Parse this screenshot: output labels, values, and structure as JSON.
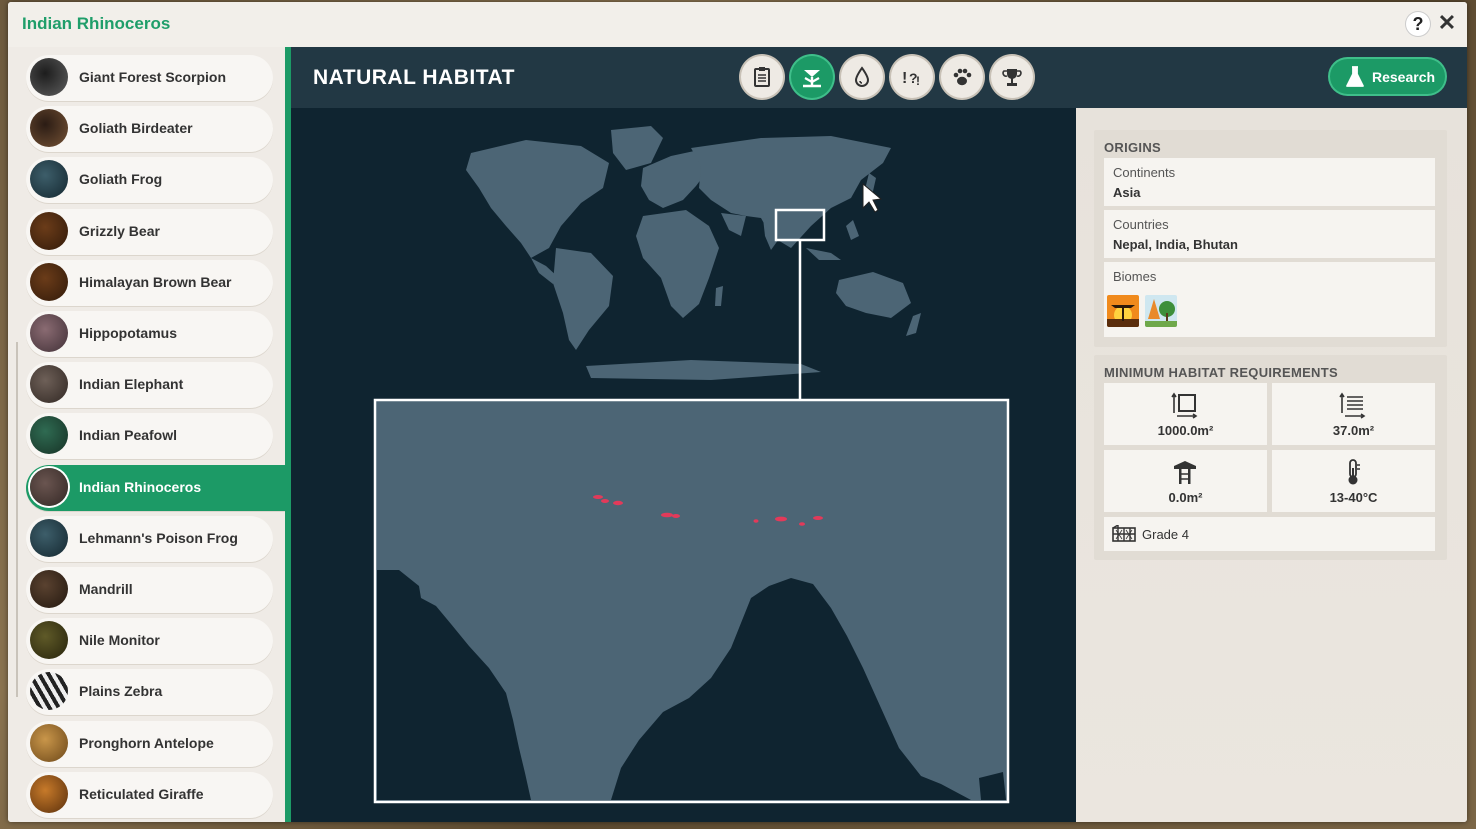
{
  "window": {
    "title": "Indian Rhinoceros",
    "help_label": "?",
    "close_label": "✕"
  },
  "sidebar": {
    "items": [
      {
        "label": "Giant Forest Scorpion",
        "icon": "scorpion-icon",
        "selected": false
      },
      {
        "label": "Goliath Birdeater",
        "icon": "spider-icon",
        "selected": false
      },
      {
        "label": "Goliath Frog",
        "icon": "frog-icon",
        "selected": false
      },
      {
        "label": "Grizzly Bear",
        "icon": "bear-icon",
        "selected": false
      },
      {
        "label": "Himalayan Brown Bear",
        "icon": "bear-icon",
        "selected": false
      },
      {
        "label": "Hippopotamus",
        "icon": "hippo-icon",
        "selected": false
      },
      {
        "label": "Indian Elephant",
        "icon": "elephant-icon",
        "selected": false
      },
      {
        "label": "Indian Peafowl",
        "icon": "peafowl-icon",
        "selected": false
      },
      {
        "label": "Indian Rhinoceros",
        "icon": "rhino-icon",
        "selected": true
      },
      {
        "label": "Lehmann's Poison Frog",
        "icon": "frog-icon",
        "selected": false
      },
      {
        "label": "Mandrill",
        "icon": "mandrill-icon",
        "selected": false
      },
      {
        "label": "Nile Monitor",
        "icon": "lizard-icon",
        "selected": false
      },
      {
        "label": "Plains Zebra",
        "icon": "zebra-icon",
        "selected": false
      },
      {
        "label": "Pronghorn Antelope",
        "icon": "antelope-icon",
        "selected": false
      },
      {
        "label": "Reticulated Giraffe",
        "icon": "giraffe-icon",
        "selected": false
      }
    ]
  },
  "header": {
    "title": "NATURAL HABITAT",
    "tabs": [
      {
        "icon": "clipboard-icon",
        "active": false
      },
      {
        "icon": "habitat-icon",
        "active": true
      },
      {
        "icon": "water-drop-icon",
        "active": false
      },
      {
        "icon": "behaviour-icon",
        "active": false
      },
      {
        "icon": "paw-icon",
        "active": false
      },
      {
        "icon": "trophy-icon",
        "active": false
      }
    ],
    "research_label": "Research"
  },
  "origins": {
    "title": "ORIGINS",
    "continents_label": "Continents",
    "continents_value": "Asia",
    "countries_label": "Countries",
    "countries_value": "Nepal, India, Bhutan",
    "biomes_label": "Biomes",
    "biomes": [
      "savanna-biome-icon",
      "temperate-forest-biome-icon"
    ]
  },
  "requirements": {
    "title": "MINIMUM HABITAT REQUIREMENTS",
    "land_area": "1000.0m²",
    "water_area": "37.0m²",
    "climbing_area": "0.0m²",
    "temperature": "13-40°C",
    "fence_grade": "Grade 4"
  },
  "colors": {
    "accent": "#1c9a66",
    "header_bg": "#223844",
    "map_bg": "#0f2430",
    "land": "#4c6575",
    "range": "#e23a5a"
  }
}
